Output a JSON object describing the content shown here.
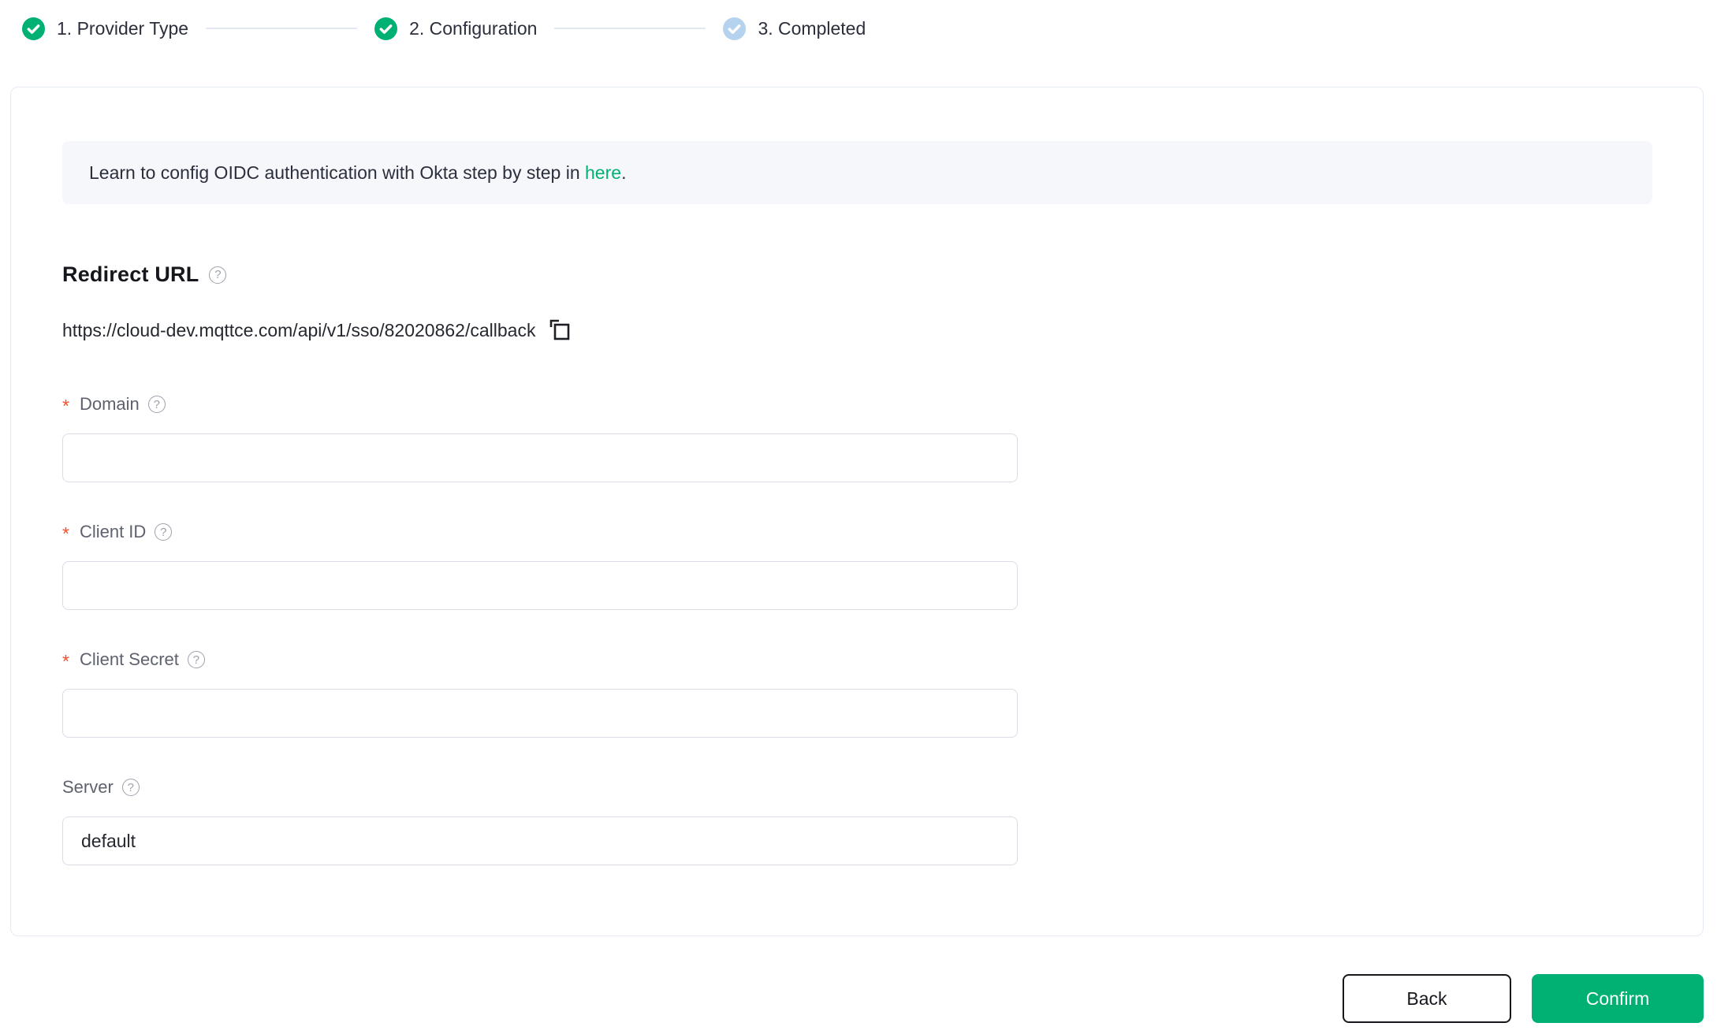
{
  "stepper": {
    "steps": [
      {
        "label": "1. Provider Type",
        "state": "completed"
      },
      {
        "label": "2. Configuration",
        "state": "completed"
      },
      {
        "label": "3. Completed",
        "state": "pending"
      }
    ]
  },
  "banner": {
    "text_before_link": "Learn to config OIDC authentication with Okta step by step in ",
    "link_label": "here",
    "text_after_link": "."
  },
  "redirect": {
    "heading": "Redirect URL",
    "url": "https://cloud-dev.mqttce.com/api/v1/sso/82020862/callback"
  },
  "form": {
    "required_marker": "*",
    "fields": [
      {
        "label": "Domain",
        "required": true,
        "value": ""
      },
      {
        "label": "Client ID",
        "required": true,
        "value": ""
      },
      {
        "label": "Client Secret",
        "required": true,
        "value": ""
      },
      {
        "label": "Server",
        "required": false,
        "value": "default"
      }
    ]
  },
  "actions": {
    "back_label": "Back",
    "confirm_label": "Confirm"
  },
  "icons": {
    "help_glyph": "?"
  },
  "colors": {
    "accent_green": "#00b173",
    "pending_step_blue": "#b5d2ee",
    "required_red": "#f0502f"
  }
}
